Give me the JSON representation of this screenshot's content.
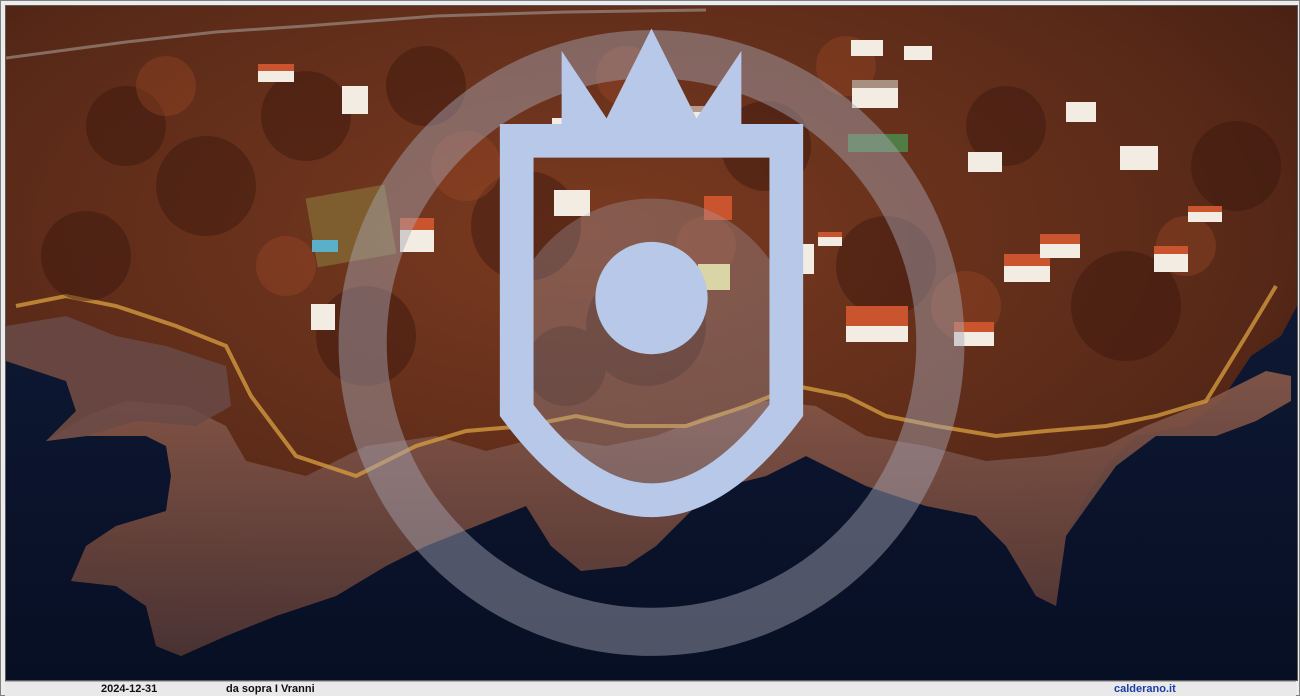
{
  "photo": {
    "subject": "aerial-coastline-with-villas",
    "colors": {
      "sea": "#0b1630",
      "vegetation_dark": "#4a1f14",
      "vegetation_warm": "#8a3a22",
      "cliff_rock": "#6b4a44",
      "sunlit_edge": "#d9a040",
      "roof": "#c9542e",
      "wall": "#f2ece2"
    }
  },
  "caption": {
    "date": "2024-12-31",
    "title": "da sopra I Vranni",
    "site": "calderano.it"
  },
  "icons": {
    "emblem": "coat-of-arms-icon",
    "watermark": "watermark-seal-icon"
  }
}
